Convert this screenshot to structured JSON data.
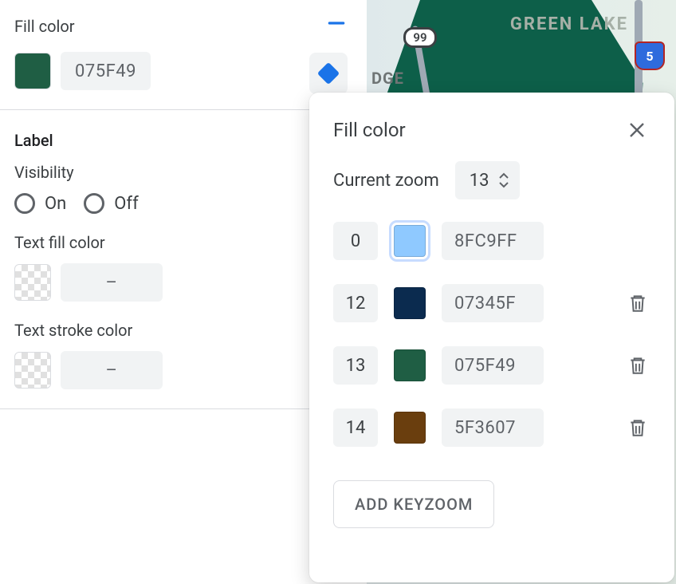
{
  "sidebar": {
    "fill_section_title": "Fill color",
    "fill_hex": "075F49",
    "fill_swatch_color": "#1f5e44",
    "label_section_title": "Label",
    "visibility_label": "Visibility",
    "visibility_on": "On",
    "visibility_off": "Off",
    "text_fill_label": "Text fill color",
    "text_fill_hex": "–",
    "text_stroke_label": "Text stroke color",
    "text_stroke_hex": "–"
  },
  "map": {
    "lake_label": "GREEN LAKE",
    "hwy99": "99",
    "i5": "5",
    "edge_text": "DGE"
  },
  "popover": {
    "title": "Fill color",
    "current_zoom_label": "Current zoom",
    "current_zoom_value": "13",
    "add_keyzoom_label": "ADD KEYZOOM",
    "rows": [
      {
        "zoom": "0",
        "hex": "8FC9FF",
        "color": "#8fc9ff",
        "deletable": false,
        "selected": true
      },
      {
        "zoom": "12",
        "hex": "07345F",
        "color": "#0b2b4f",
        "deletable": true,
        "selected": false
      },
      {
        "zoom": "13",
        "hex": "075F49",
        "color": "#1f5e44",
        "deletable": true,
        "selected": false
      },
      {
        "zoom": "14",
        "hex": "5F3607",
        "color": "#6a3e0e",
        "deletable": true,
        "selected": false
      }
    ]
  }
}
